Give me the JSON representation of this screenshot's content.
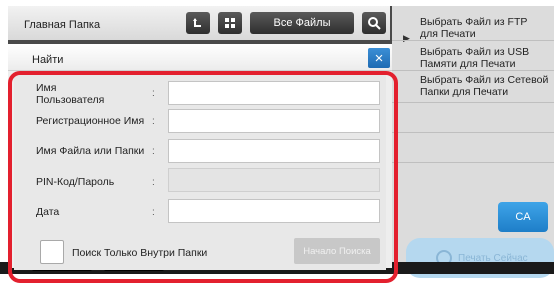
{
  "header": {
    "title": "Главная Папка",
    "all_files": "Все Файлы"
  },
  "dialog": {
    "title": "Найти",
    "close_icon": "×",
    "fields": [
      {
        "label": "Имя\nПользователя",
        "value": ""
      },
      {
        "label": "Регистрационное Имя",
        "value": ""
      },
      {
        "label": "Имя Файла или Папки",
        "value": ""
      },
      {
        "label": "PIN-Код/Пароль",
        "value": ""
      },
      {
        "label": "Дата",
        "value": ""
      }
    ],
    "checkbox_label": "Поиск Только Внутри Папки",
    "search_button": "Начало Поиска"
  },
  "right_panel": {
    "items": [
      "Выбрать Файл из FTP для Печати",
      "Выбрать Файл из USB Памяти для Печати",
      "Выбрать Файл из Сетевой Папки для Печати"
    ],
    "ca_button": "CA",
    "start_button": "Печать Сейчас"
  },
  "icons": {
    "up": "up-folder-icon",
    "grid": "grid-view-icon",
    "search": "search-icon",
    "close": "close-icon",
    "arrow": "triangle-right-icon",
    "start": "circle-icon"
  },
  "colors": {
    "highlight": "#e3202e",
    "close_button": "#2b7cc5",
    "ca_button": "#2a8fd8"
  }
}
